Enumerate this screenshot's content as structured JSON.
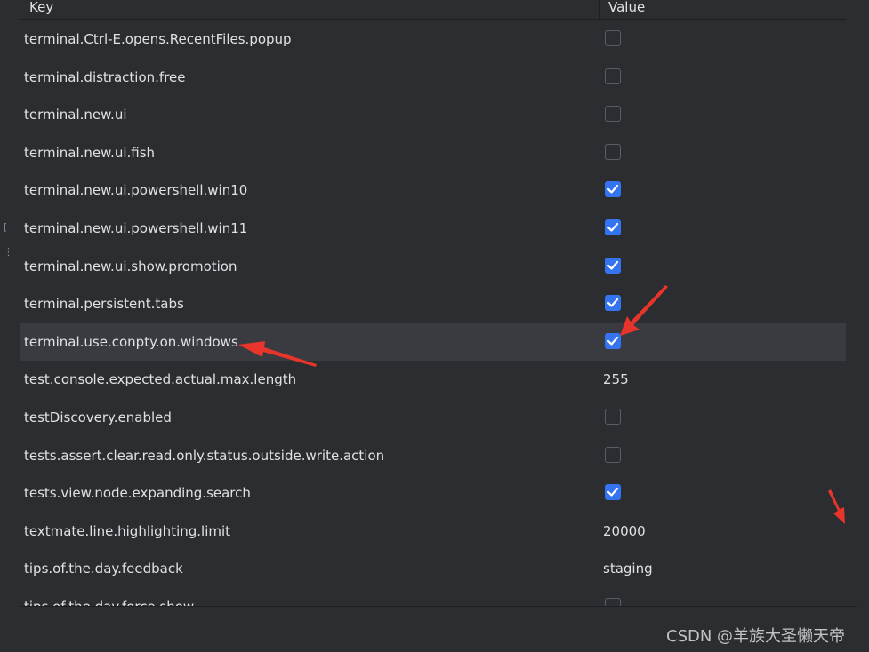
{
  "table": {
    "header": {
      "key_label": "Key",
      "value_label": "Value"
    },
    "selected_row": 8,
    "rows": [
      {
        "key": "terminal.Ctrl-E.opens.RecentFiles.popup",
        "type": "checkbox",
        "checked": false
      },
      {
        "key": "terminal.distraction.free",
        "type": "checkbox",
        "checked": false
      },
      {
        "key": "terminal.new.ui",
        "type": "checkbox",
        "checked": false
      },
      {
        "key": "terminal.new.ui.fish",
        "type": "checkbox",
        "checked": false
      },
      {
        "key": "terminal.new.ui.powershell.win10",
        "type": "checkbox",
        "checked": true
      },
      {
        "key": "terminal.new.ui.powershell.win11",
        "type": "checkbox",
        "checked": true
      },
      {
        "key": "terminal.new.ui.show.promotion",
        "type": "checkbox",
        "checked": true
      },
      {
        "key": "terminal.persistent.tabs",
        "type": "checkbox",
        "checked": true
      },
      {
        "key": "terminal.use.conpty.on.windows",
        "type": "checkbox",
        "checked": true
      },
      {
        "key": "test.console.expected.actual.max.length",
        "type": "text",
        "value": "255"
      },
      {
        "key": "testDiscovery.enabled",
        "type": "checkbox",
        "checked": false
      },
      {
        "key": "tests.assert.clear.read.only.status.outside.write.action",
        "type": "checkbox",
        "checked": false
      },
      {
        "key": "tests.view.node.expanding.search",
        "type": "checkbox",
        "checked": true
      },
      {
        "key": "textmate.line.highlighting.limit",
        "type": "text",
        "value": "20000"
      },
      {
        "key": "tips.of.the.day.feedback",
        "type": "text",
        "value": "staging"
      },
      {
        "key": "tips.of.the.day.force.show",
        "type": "checkbox",
        "checked": false
      }
    ]
  },
  "watermark": "CSDN @羊族大圣懒天帝",
  "colors": {
    "background": "#2b2d30",
    "selected_row": "#393b40",
    "checkbox_checked": "#3574f0",
    "annotation_arrow": "#e8352c"
  }
}
